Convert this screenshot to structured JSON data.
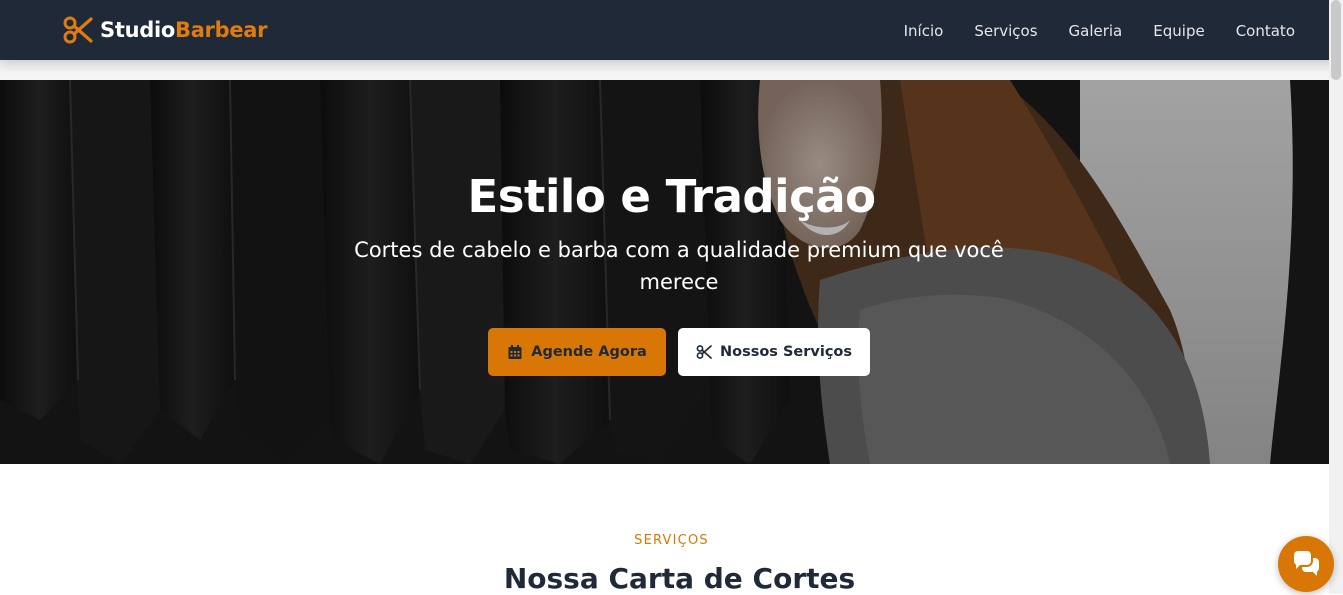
{
  "brand": {
    "name_part1": "Studio",
    "name_part2": "Barbear",
    "icon": "scissors-icon",
    "accent_color": "#e07b0f"
  },
  "nav": {
    "items": [
      {
        "label": "Início"
      },
      {
        "label": "Serviços"
      },
      {
        "label": "Galeria"
      },
      {
        "label": "Equipe"
      },
      {
        "label": "Contato"
      }
    ]
  },
  "hero": {
    "title": "Estilo e Tradição",
    "subtitle": "Cortes de cabelo e barba com a qualidade premium que você merece",
    "primary_button": {
      "label": "Agende Agora",
      "icon": "calendar-icon"
    },
    "secondary_button": {
      "label": "Nossos Serviços",
      "icon": "scissors-icon"
    }
  },
  "services": {
    "eyebrow": "SERVIÇOS",
    "title": "Nossa Carta de Cortes"
  },
  "chat": {
    "icon": "chat-bubbles-icon"
  },
  "colors": {
    "navbar_bg": "#1f2937",
    "accent": "#d97706",
    "text_dark": "#1f2937"
  }
}
